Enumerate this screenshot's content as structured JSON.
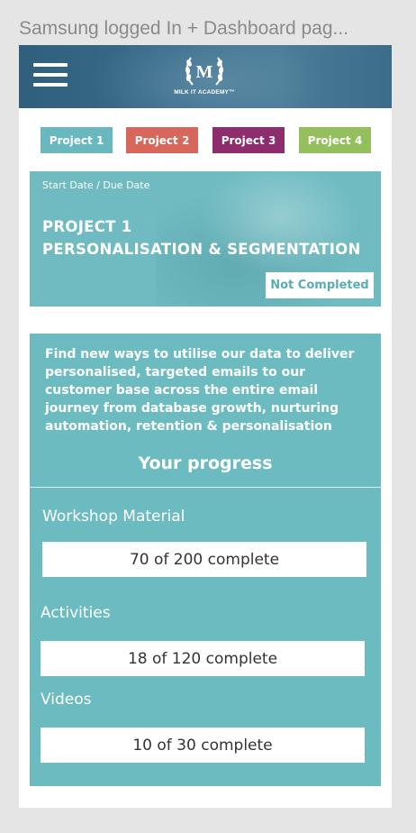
{
  "artboard": {
    "title": "Samsung logged In + Dashboard pag..."
  },
  "header": {
    "menu_icon": "hamburger-icon",
    "logo_letter": "M",
    "logo_text": "MILK IT ACADEMY™"
  },
  "tabs": [
    {
      "label": "Project 1",
      "color": "#6ab8bf"
    },
    {
      "label": "Project 2",
      "color": "#d7675a"
    },
    {
      "label": "Project 3",
      "color": "#8e2d6d"
    },
    {
      "label": "Project 4",
      "color": "#93c05c"
    }
  ],
  "hero": {
    "dates_label": "Start Date / Due Date",
    "title_line1": "PROJECT 1",
    "title_line2": "PERSONALISATION & SEGMENTATION",
    "status": "Not Completed"
  },
  "panel": {
    "description": "Find new ways to utilise our data to deliver personalised, targeted emails to our customer base across the entire email journey from database growth, nurturing automation, retention & personalisation",
    "progress_heading": "Your progress",
    "sections": [
      {
        "label": "Workshop Material",
        "progress": "70 of 200 complete",
        "done": 70,
        "total": 200
      },
      {
        "label": "Activities",
        "progress": "18 of 120 complete",
        "done": 18,
        "total": 120
      },
      {
        "label": "Videos",
        "progress": "10 of 30 complete",
        "done": 10,
        "total": 30
      }
    ]
  },
  "colors": {
    "accent": "#6cbbc0",
    "header": "#3b6f8d"
  }
}
